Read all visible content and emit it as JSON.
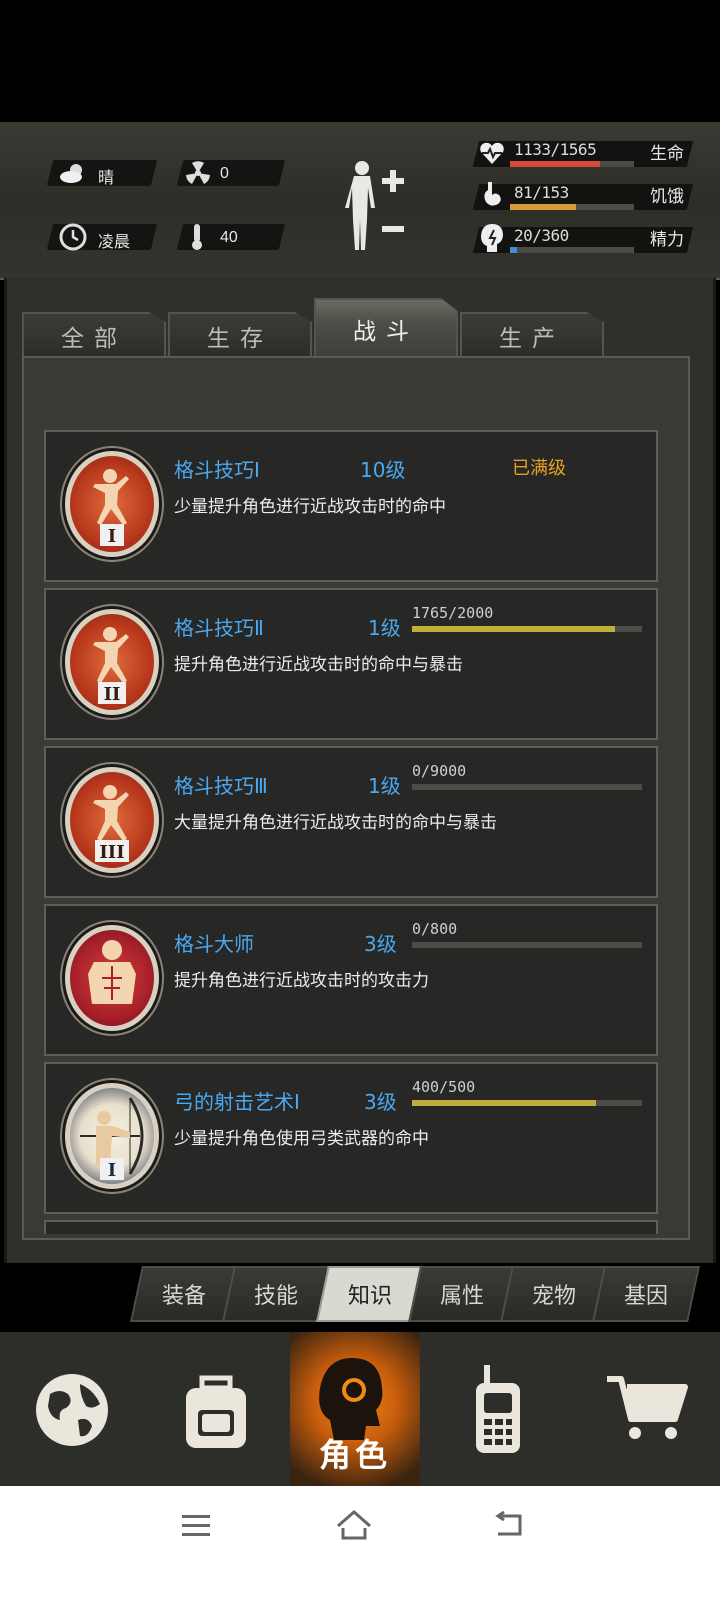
{
  "header": {
    "weather": "晴",
    "radiation": "0",
    "time_of_day": "凌晨",
    "temperature": "40",
    "stats": [
      {
        "value": "1133/1565",
        "label": "生命",
        "fraction": 0.724,
        "color": "#d8493a",
        "icon": "heart-pulse-icon"
      },
      {
        "value": "81/153",
        "label": "饥饿",
        "fraction": 0.529,
        "color": "#d79a37",
        "icon": "stomach-icon"
      },
      {
        "value": "20/360",
        "label": "精力",
        "fraction": 0.056,
        "color": "#3d8fd8",
        "icon": "brain-energy-icon"
      }
    ]
  },
  "tabs": [
    {
      "label": "全部",
      "active": false
    },
    {
      "label": "生存",
      "active": false
    },
    {
      "label": "战斗",
      "active": true
    },
    {
      "label": "生产",
      "active": false
    }
  ],
  "skills": [
    {
      "name": "格斗技巧Ⅰ",
      "level": "10级",
      "status": "已满级",
      "desc": "少量提升角色进行近战攻击时的命中",
      "progress_text": "",
      "fraction": 1.0,
      "icon": "fighter-stance-icon",
      "numeral": "I"
    },
    {
      "name": "格斗技巧Ⅱ",
      "level": "1级",
      "status": "",
      "desc": "提升角色进行近战攻击时的命中与暴击",
      "progress_text": "1765/2000",
      "fraction": 0.8825,
      "icon": "fighter-stance-icon",
      "numeral": "II"
    },
    {
      "name": "格斗技巧Ⅲ",
      "level": "1级",
      "status": "",
      "desc": "大量提升角色进行近战攻击时的命中与暴击",
      "progress_text": "0/9000",
      "fraction": 0.0,
      "icon": "fighter-stance-icon",
      "numeral": "III"
    },
    {
      "name": "格斗大师",
      "level": "3级",
      "status": "",
      "desc": "提升角色进行近战攻击时的攻击力",
      "progress_text": "0/800",
      "fraction": 0.0,
      "icon": "muscle-torso-icon",
      "numeral": ""
    },
    {
      "name": "弓的射击艺术Ⅰ",
      "level": "3级",
      "status": "",
      "desc": "少量提升角色使用弓类武器的命中",
      "progress_text": "400/500",
      "fraction": 0.8,
      "icon": "archer-icon",
      "numeral": "I"
    }
  ],
  "subtabs": [
    {
      "label": "装备",
      "active": false
    },
    {
      "label": "技能",
      "active": false
    },
    {
      "label": "知识",
      "active": true
    },
    {
      "label": "属性",
      "active": false
    },
    {
      "label": "宠物",
      "active": false
    },
    {
      "label": "基因",
      "active": false
    }
  ],
  "nav": [
    {
      "label": "",
      "icon": "globe-icon"
    },
    {
      "label": "",
      "icon": "backpack-icon"
    },
    {
      "label": "角色",
      "icon": "character-head-icon",
      "active": true
    },
    {
      "label": "",
      "icon": "walkie-talkie-icon"
    },
    {
      "label": "",
      "icon": "shopping-cart-icon"
    }
  ]
}
